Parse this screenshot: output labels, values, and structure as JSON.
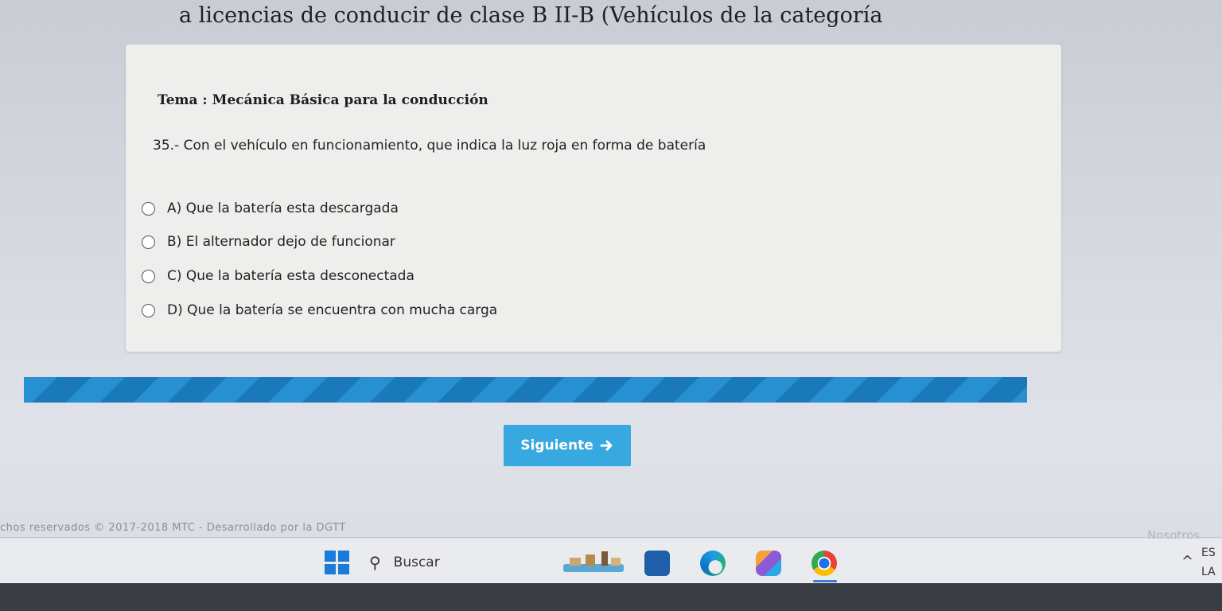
{
  "page": {
    "title": "a licencias de conducir de clase B II-B (Vehículos de la categoría"
  },
  "quiz": {
    "topic": "Tema : Mecánica Básica para la conducción",
    "question": "35.- Con el vehículo en funcionamiento, que indica la luz roja en forma de batería",
    "options": [
      {
        "label": "A) Que la batería esta descargada"
      },
      {
        "label": "B) El alternador dejo de funcionar"
      },
      {
        "label": "C) Que la batería esta desconectada"
      },
      {
        "label": "D) Que la batería se encuentra con mucha carga"
      }
    ],
    "progress_percent": 100,
    "next_label": "Siguiente",
    "next_icon": "arrow-right-icon"
  },
  "footer": {
    "text": "chos reservados © 2017-2018 MTC - Desarrollado por la DGTT",
    "right_text": "Nosotros"
  },
  "taskbar": {
    "search_label": "Buscar",
    "lang_line1": "ES",
    "lang_line2": "LA",
    "tray_chevron": "^"
  },
  "colors": {
    "accent": "#37a8e0",
    "progress": "#1f86c9"
  }
}
